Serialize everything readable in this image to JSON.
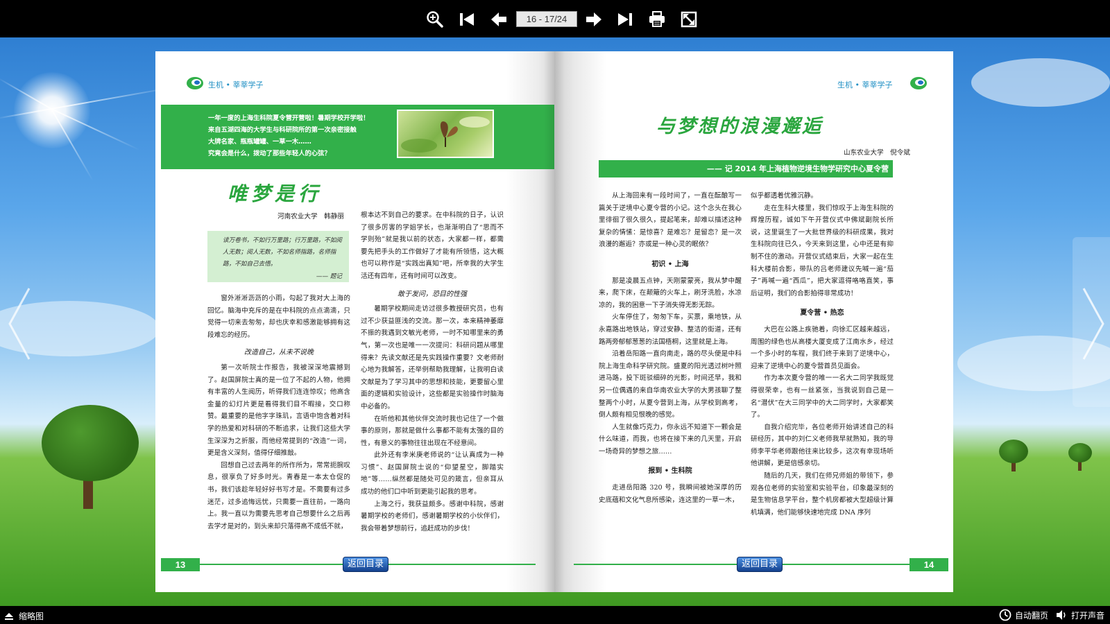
{
  "toolbar": {
    "page_indicator": "16 - 17/24",
    "icons": [
      "zoom-in-icon",
      "first-page-icon",
      "prev-page-icon",
      "next-page-icon",
      "last-page-icon",
      "print-icon",
      "fullscreen-icon"
    ]
  },
  "bottombar": {
    "thumbnails_label": "缩略图",
    "autoflip_label": "自动翻页",
    "sound_label": "打开声音"
  },
  "left_page": {
    "header": "生机 • 莘莘学子",
    "intro": [
      "一年一度的上海生科院夏令营开营啦！暑期学校开学啦！",
      "来自五湖四海的大学生与科研院所的第一次亲密接触",
      "大牌名家、瓶瓶罐罐、一草一木……",
      "究竟会是什么，拨动了那些年轻人的心弦？"
    ],
    "title": "唯梦是行",
    "author": "河南农业大学　韩静丽",
    "quote": "读万卷书，不如行万里路；行万里路，不如阅人无数；阅人无数，不如名师指路，名师指路，不如自己去悟。",
    "quote_source": "—— 题记",
    "col1_p1": "窗外淅淅沥沥的小雨，勾起了我对大上海的回忆。脑海中充斥的是在中科院的点点滴滴，只觉得一切来去匆匆，却也庆幸和感激能够拥有这段难忘的经历。",
    "col1_sub": "改造自己，从未不说晚",
    "col1_p2": "第一次听院士作报告，我被深深地震撼到了。赵国屏院士真的是一位了不起的人物，他拥有丰富的人生阅历，听得我们连连惊叹；他高含金量的幻灯片更是看得我们目不暇接，交口称赞。最重要的是他字字珠玑，言语中饱含着对科学的热爱和对科研的不断追求，让我们这些大学生深深为之折服，而他经常提到的“改造”一词，更是含义深刻，值得仔细推敲。",
    "col1_p3": "回想自己过去两年的所作所为，常常扼腕叹息，很享负了好多时光。青春是一本太仓促的书，我们该趁年轻好好书写才是。不需要有过多迷茫，过多追悔远忧，只需要一直往前，一路向上。我一直以为需要先思考自己想要什么之后再去学才是对的，到头来却只落得高不成低不就，",
    "col2_p1": "根本达不到自己的要求。在中科院的日子，认识了很多厉害的学姐学长，也渐渐明白了“思而不学则殆”就是我以前的状态，大家都一样，都需要先把手头的工作做好了才能有所领悟，这大概也可以称作是“实践出真知”吧，所幸我的大学生活还有四年，还有时间可以改变。",
    "col2_sub": "敢于发问，恐目的性强",
    "col2_p2": "暑期学校期间走访过很多教授研究员，也有过不少获益匪浅的交流。那一次，本来精神萎靡不振的我遇到文敏光老师，一时不知哪里来的勇气，第一次也是唯一一次提问：科研问题从哪里得来？先读文献还是先实践操作重要？文老师耐心地为我解答，还举例帮助我理解，让我明白读文献是为了学习其中的思想和技能，更要留心里面的逻辑和实验设计，这些都是实验操作时脑海中必备的。",
    "col2_p3": "在听他和其他伙伴交流时我也记住了一个做事的原则，那就是做什么事都不能有太强的目的性，有意义的事物往往出现在不经意间。",
    "col2_p4": "此外还有李米庚老师说的“让认真成为一种习惯”、赵国屏院士说的“仰望星空，脚踏实地”等……纵然都是随处可见的箴言，但亲耳从成功的他们口中听到更能引起我的思考。",
    "col2_p5": "上海之行，我获益颇多。感谢中科院，感谢暑期学校的老师们，感谢暑期学校的小伙伴们，我会带着梦想前行，追赶成功的步伐！",
    "page_number": "13",
    "back_label": "返回目录"
  },
  "right_page": {
    "header": "生机 • 莘莘学子",
    "title": "与梦想的浪漫邂逅",
    "author": "山东农业大学　倪令斌",
    "subtitle": "—— 记 2014 年上海植物逆境生物学研究中心夏令营",
    "col1_p1": "从上海回来有一段时间了，一直在酝酿写一篇关于逆境中心夏令营的小记。这个念头在我心里徘徊了很久很久，提起笔来，却难以描述这种复杂的情愫：是惊喜？是难忘？是留恋？是一次浪漫的邂逅？亦或是一种心灵的眠依？",
    "col1_sub1": "初识 • 上海",
    "col1_p2": "那是凌晨五点钟，天刚蒙蒙亮，我从梦中醒来，爬下床，在颠簸的火车上，刷牙洗脸，水凉凉的，我的困意一下子消失得无影无踪。",
    "col1_p3": "火车停住了，匆匆下车，买票，乘地铁，从永嘉路出地铁站，穿过安静、整洁的街道，还有路两旁郁郁葱葱的法国梧桐，这里就是上海。",
    "col1_p4": "沿着岳阳路一直向南走，路的尽头便是中科院上海生命科学研究院。盛夏的阳光透过树叶照进马路，投下斑驳细碎的光影，时间还早，我和另一位偶遇的来自华南农业大学的大男孩聊了整整两个小时，从夏令营到上海，从学校到高考，倒人颇有相见恨晚的感觉。",
    "col1_p5": "人生就像巧克力，你永远不知道下一颗会是什么味道，而我，也将在接下来的几天里，开启一场奇异的梦想之旅……",
    "col1_sub2": "报到 • 生科院",
    "col1_p6": "走进岳阳路 320 号，我瞬间被她深厚的历史底蕴和文化气息所感染，连这里的一草一木，",
    "col2_p1": "似乎都透着优雅沉静。",
    "col2_p2": "走在生科大楼里，我们惊叹于上海生科院的辉煌历程，诚如下午开营仪式中佛斌副院长所说，这里诞生了一大批世界级的科研成果，我对生科院向往已久，今天来到这里，心中还是有抑制不住的激动。开营仪式结束后，大家一起在生科大楼前合影，带队的吕老师建议先喊一遍“茄子”再喊一遍“西瓜”，把大家逗得咯咯直笑，事后证明，我们的合影拍得非常成功！",
    "col2_sub1": "夏令营 • 热恋",
    "col2_p3": "大巴在公路上疾驰着，向徐汇区越来越远，周围的绿色也从高楼大厦变成了江南水乡，经过一个多小时的车程，我们终于来到了逆境中心，迎来了逆境中心的夏令营首员见面会。",
    "col2_p4": "作为本次夏令营的唯一一名大二同学我既觉得很荣幸，也有一丝紧张，当我说到自己是一名“潜伏”在大三同学中的大二同学时，大家都笑了。",
    "col2_p5": "自我介绍完毕，各位老师开始讲述自己的科研经历，其中的刘仁义老师我早就熟知，我的导师李平华老师跟他往来比较多，这次有幸现场听他讲解，更是倍感亲切。",
    "col2_p6": "随后的几天，我们在师兄师姐的带领下，参观各位老师的实验室和实验平台，印象最深刻的是生物信息学平台，整个机房都被大型超级计算机填满，他们能够快速地完成 DNA 序列",
    "page_number": "14",
    "back_label": "返回目录"
  },
  "colors": {
    "green": "#32b04a",
    "header_blue": "#1f8fc4",
    "toolbar": "#000000"
  }
}
